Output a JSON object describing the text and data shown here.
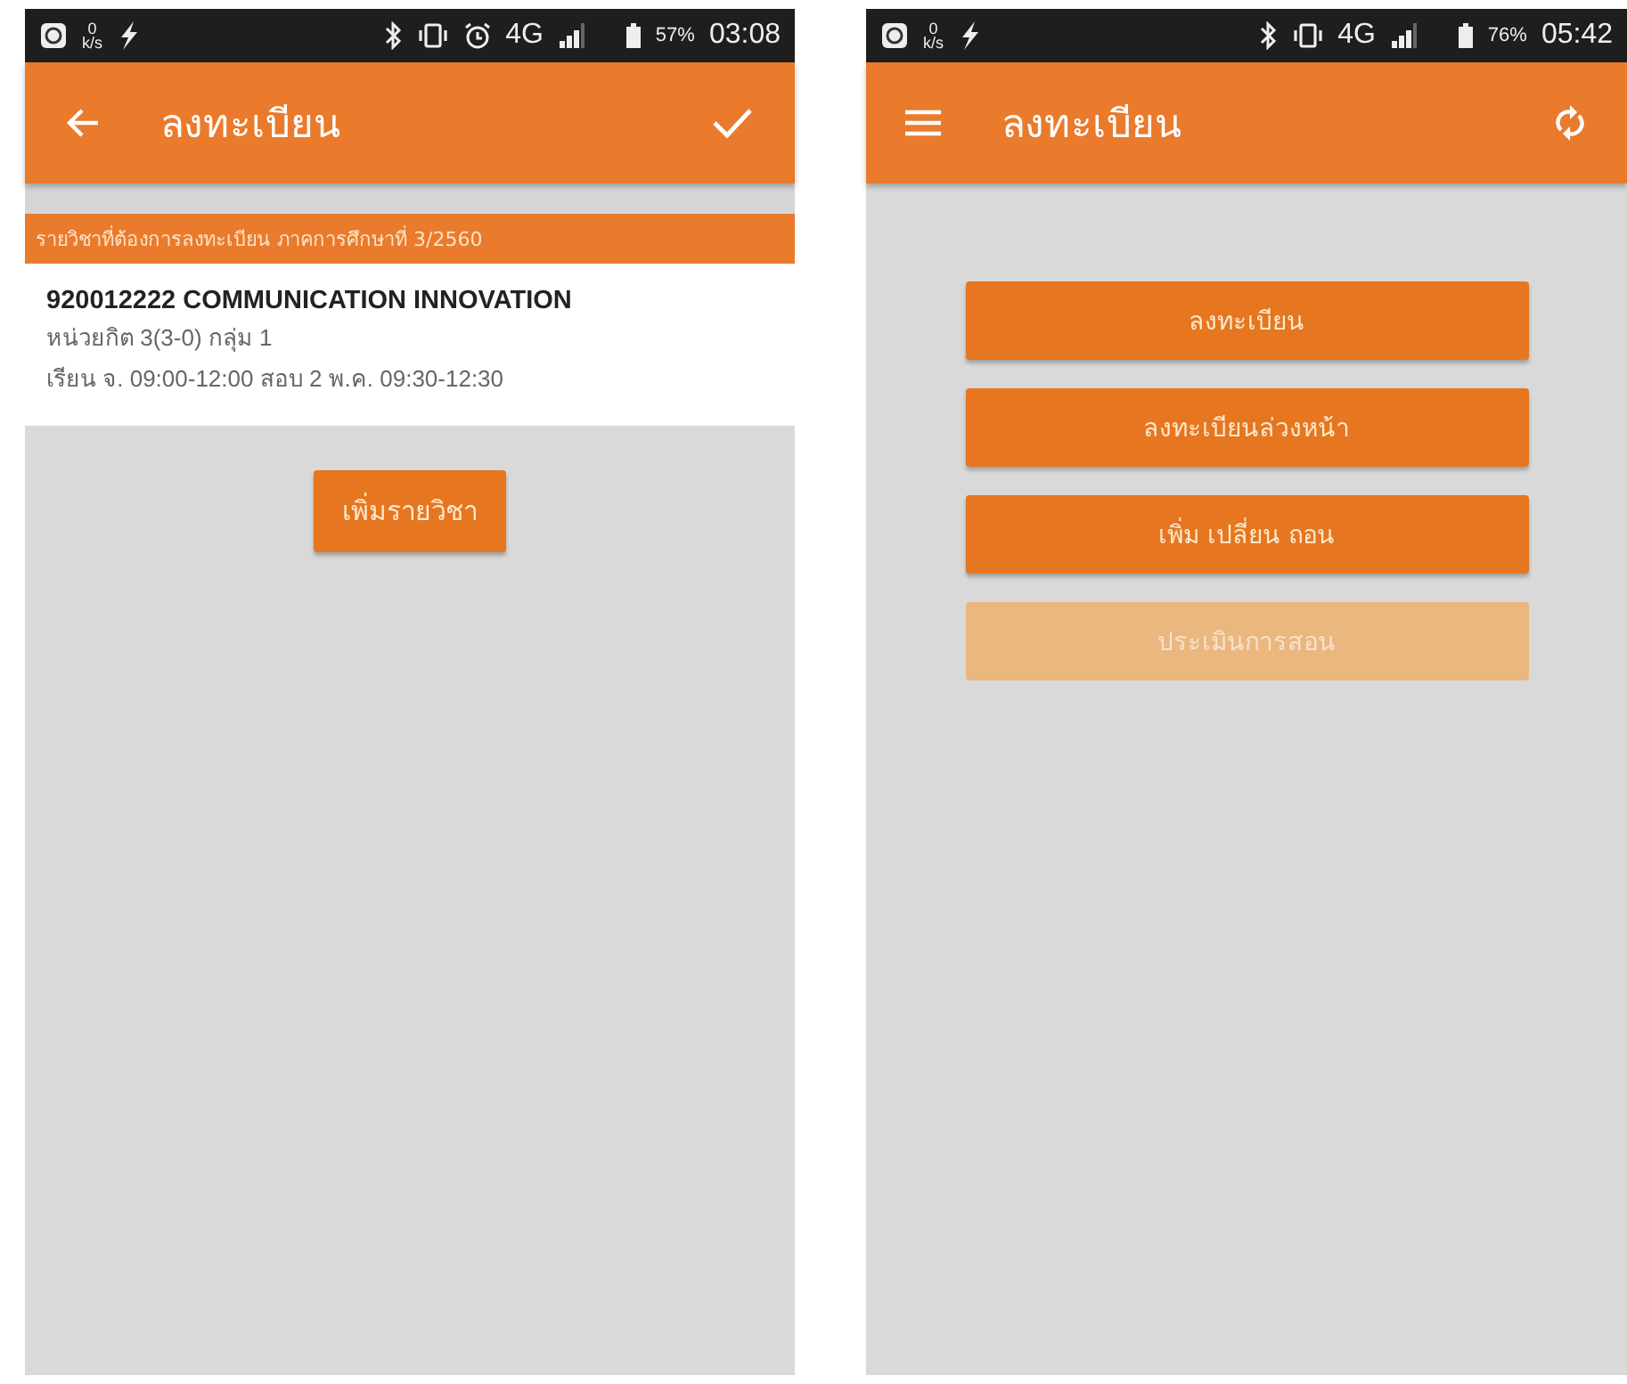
{
  "screens": [
    {
      "kind": "course_list",
      "status_bar": {
        "speed_value": "0",
        "speed_unit": "k/s",
        "alarm": true,
        "network": "4G",
        "battery": "57%",
        "time": "03:08"
      },
      "app_bar": {
        "nav": {
          "kind": "back"
        },
        "title": "ลงทะเบียน",
        "action": {
          "kind": "check"
        }
      },
      "banner": "รายวิชาที่ต้องการลงทะเบียน ภาคการศึกษาที่ 3/2560",
      "course": {
        "title": "920012222 COMMUNICATION INNOVATION",
        "credits": "หน่วยกิต 3(3-0) กลุ่ม 1",
        "schedule": "เรียน จ. 09:00-12:00 สอบ 2 พ.ค. 09:30-12:30"
      },
      "add_button": "เพิ่มรายวิชา"
    },
    {
      "kind": "menu",
      "status_bar": {
        "speed_value": "0",
        "speed_unit": "k/s",
        "alarm": false,
        "network": "4G",
        "battery": "76%",
        "time": "05:42"
      },
      "app_bar": {
        "nav": {
          "kind": "menu"
        },
        "title": "ลงทะเบียน",
        "action": {
          "kind": "refresh"
        }
      },
      "menu_buttons": [
        {
          "label": "ลงทะเบียน",
          "disabled": false
        },
        {
          "label": "ลงทะเบียนล่วงหน้า",
          "disabled": false
        },
        {
          "label": "เพิ่ม เปลี่ยน ถอน",
          "disabled": false
        },
        {
          "label": "ประเมินการสอน",
          "disabled": true
        }
      ]
    }
  ]
}
